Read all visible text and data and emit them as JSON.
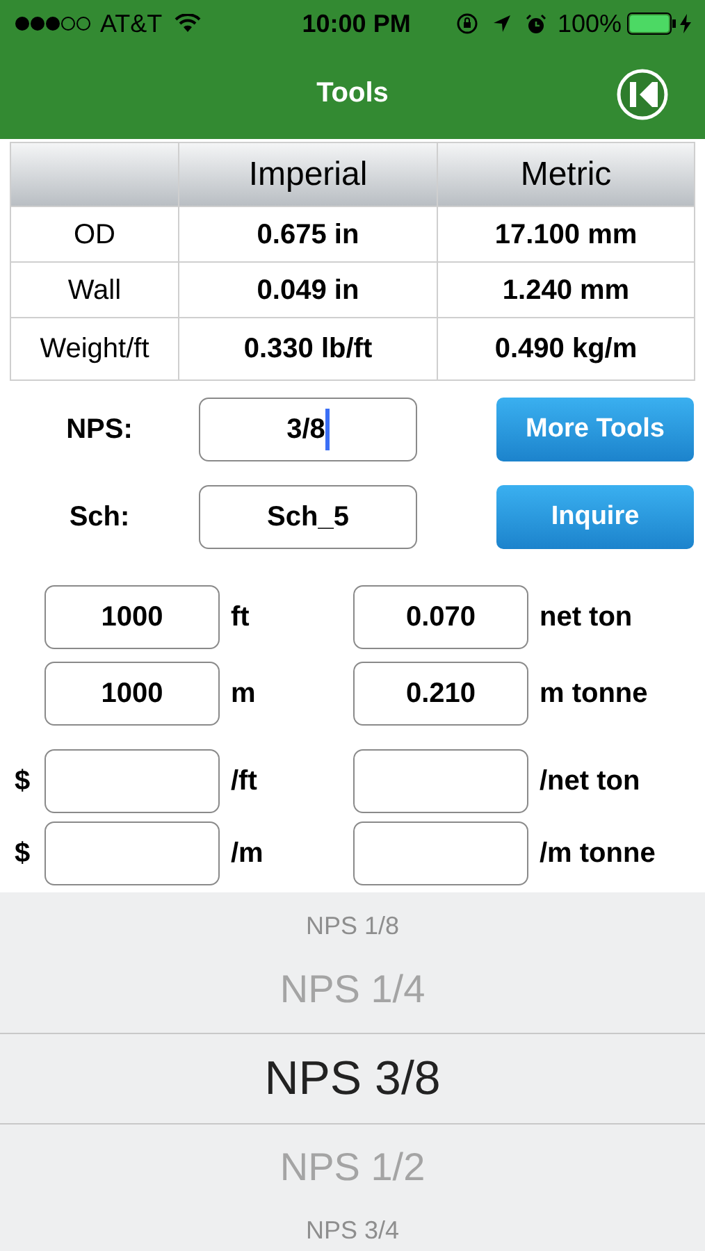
{
  "status_bar": {
    "carrier": "AT&T",
    "time": "10:00 PM",
    "battery": "100%"
  },
  "nav_bar": {
    "title": "Tools"
  },
  "table": {
    "columns": [
      "Imperial",
      "Metric"
    ],
    "rows": [
      {
        "label": "OD",
        "imperial": "0.675 in",
        "metric": "17.100 mm"
      },
      {
        "label": "Wall",
        "imperial": "0.049 in",
        "metric": "1.240 mm"
      },
      {
        "label": "Weight/ft",
        "imperial": "0.330 lb/ft",
        "metric": "0.490 kg/m"
      }
    ]
  },
  "selectors": [
    {
      "label": "NPS:",
      "value": "3/8",
      "focused": true,
      "button": "More Tools"
    },
    {
      "label": "Sch:",
      "value": "Sch_5",
      "focused": false,
      "button": "Inquire"
    }
  ],
  "quantities": [
    {
      "value": "1000",
      "unit": "ft",
      "weight": "0.070",
      "weight_unit": "net ton"
    },
    {
      "value": "1000",
      "unit": "m",
      "weight": "0.210",
      "weight_unit": "m tonne"
    }
  ],
  "prices": [
    {
      "currency": "$",
      "unit": "/ft",
      "weight_unit": "/net ton"
    },
    {
      "currency": "$",
      "unit": "/m",
      "weight_unit": "/m tonne"
    }
  ],
  "picker": [
    {
      "label": "NPS 1/8",
      "selected": false
    },
    {
      "label": "NPS 1/4",
      "selected": false
    },
    {
      "label": "NPS 3/8",
      "selected": true
    },
    {
      "label": "NPS 1/2",
      "selected": false
    },
    {
      "label": "NPS 3/4",
      "selected": false
    }
  ]
}
